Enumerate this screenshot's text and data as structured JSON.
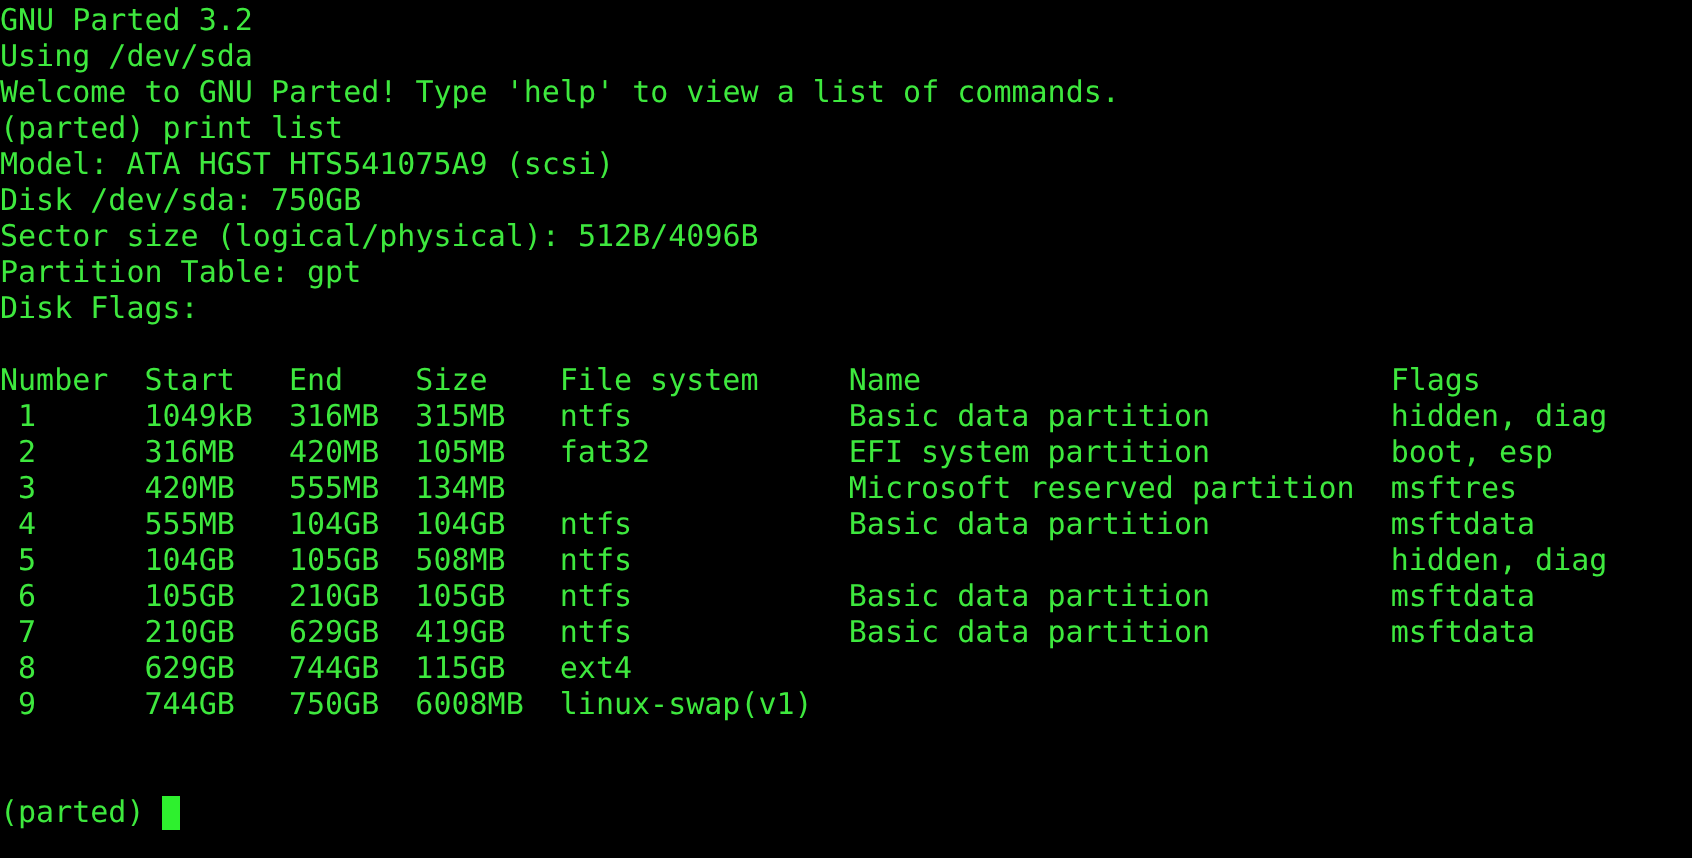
{
  "output_lines": [
    "GNU Parted 3.2",
    "Using /dev/sda",
    "Welcome to GNU Parted! Type 'help' to view a list of commands.",
    "(parted) print list",
    "Model: ATA HGST HTS541075A9 (scsi)",
    "Disk /dev/sda: 750GB",
    "Sector size (logical/physical): 512B/4096B",
    "Partition Table: gpt",
    "Disk Flags:"
  ],
  "partition_table": {
    "columns": [
      "Number",
      "Start",
      "End",
      "Size",
      "File system",
      "Name",
      "Flags"
    ],
    "rows": [
      [
        "1",
        "1049kB",
        "316MB",
        "315MB",
        "ntfs",
        "Basic data partition",
        "hidden, diag"
      ],
      [
        "2",
        "316MB",
        "420MB",
        "105MB",
        "fat32",
        "EFI system partition",
        "boot, esp"
      ],
      [
        "3",
        "420MB",
        "555MB",
        "134MB",
        null,
        "Microsoft reserved partition",
        "msftres"
      ],
      [
        "4",
        "555MB",
        "104GB",
        "104GB",
        "ntfs",
        "Basic data partition",
        "msftdata"
      ],
      [
        "5",
        "104GB",
        "105GB",
        "508MB",
        "ntfs",
        null,
        "hidden, diag"
      ],
      [
        "6",
        "105GB",
        "210GB",
        "105GB",
        "ntfs",
        "Basic data partition",
        "msftdata"
      ],
      [
        "7",
        "210GB",
        "629GB",
        "419GB",
        "ntfs",
        "Basic data partition",
        "msftdata"
      ],
      [
        "8",
        "629GB",
        "744GB",
        "115GB",
        "ext4",
        null,
        null
      ],
      [
        "9",
        "744GB",
        "750GB",
        "6008MB",
        "linux-swap(v1)",
        null,
        null
      ]
    ]
  },
  "prompt": {
    "text": "(parted)",
    "cursor_visible": true
  }
}
